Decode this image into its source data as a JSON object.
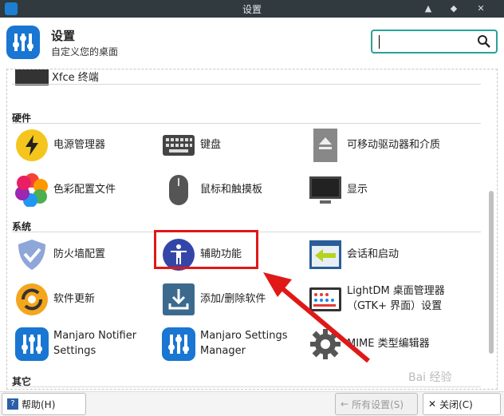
{
  "window": {
    "title": "设置"
  },
  "header": {
    "title": "设置",
    "subtitle": "自定义您的桌面"
  },
  "search": {
    "placeholder": ""
  },
  "sections": {
    "top_item": "Xfce 终端",
    "hardware": {
      "title": "硬件",
      "items": [
        "电源管理器",
        "键盘",
        "可移动驱动器和介质",
        "色彩配置文件",
        "鼠标和触摸板",
        "显示"
      ]
    },
    "system": {
      "title": "系统",
      "items": [
        "防火墙配置",
        "辅助功能",
        "会话和启动",
        "软件更新",
        "添加/删除软件",
        "LightDM 桌面管理器\n（GTK+ 界面）设置",
        "Manjaro Notifier\nSettings",
        "Manjaro Settings\nManager",
        "MIME 类型编辑器"
      ]
    },
    "other": {
      "title": "其它"
    }
  },
  "footer": {
    "help": "帮助(H)",
    "all_settings": "所有设置(S)",
    "close": "关闭(C)"
  },
  "watermark": "Bai 经验",
  "colors": {
    "titlebar": "#303a3f",
    "accent": "#1976d2",
    "highlight": "#e01818",
    "search_border": "#2aa198"
  }
}
